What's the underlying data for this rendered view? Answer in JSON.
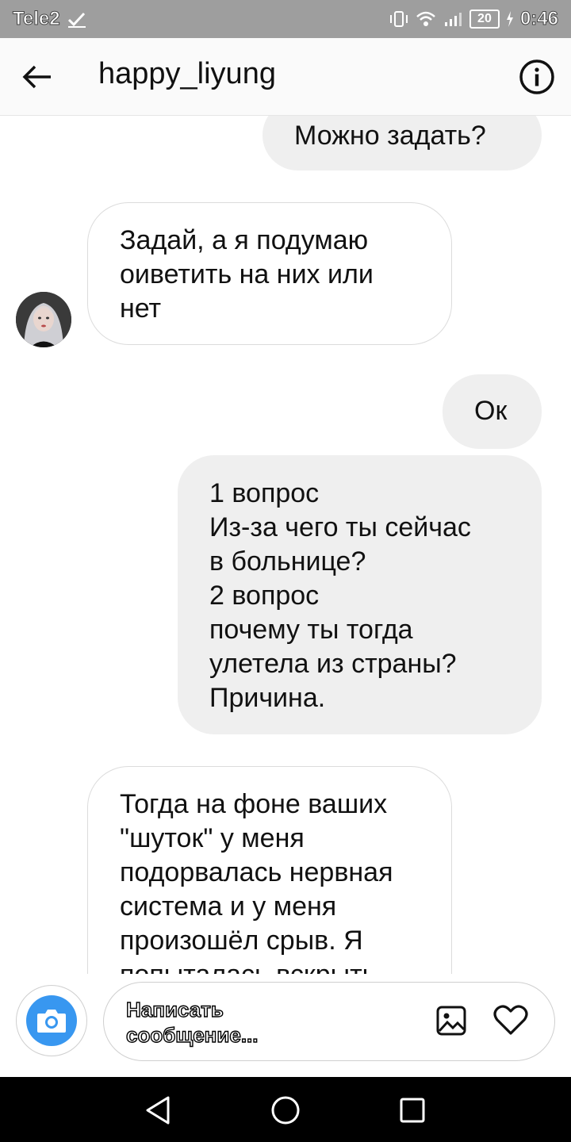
{
  "status_bar": {
    "carrier": "Tele2",
    "battery": "20",
    "time": "0:46",
    "icons": [
      "check-icon",
      "vibrate-icon",
      "wifi-icon",
      "signal-icon",
      "battery-icon",
      "charging-icon"
    ]
  },
  "header": {
    "username": "happy_liyung",
    "back_icon": "arrow-left-icon",
    "info_icon": "info-icon"
  },
  "messages": [
    {
      "sender": "me",
      "text": "Можно задать?"
    },
    {
      "sender": "them",
      "text": "Задай, а я подумаю\nоиветить на них или\nнет"
    },
    {
      "sender": "me",
      "text": "Ок"
    },
    {
      "sender": "me",
      "text": "1 вопрос\nИз-за чего ты сейчас\nв больнице?\n2 вопрос\n почему ты тогда\nулетела из страны?\nПричина."
    },
    {
      "sender": "them",
      "text": "Тогда на фоне ваших\n\"шуток\" у меня\nподорвалась нервная\nсистема и у меня\nпроизошёл срыв. Я\nпопыталась вскрыть"
    }
  ],
  "composer": {
    "placeholder": "Написать сообщение...",
    "camera_icon": "camera-icon",
    "gallery_icon": "image-icon",
    "like_icon": "heart-icon"
  },
  "colors": {
    "accent": "#3897f0",
    "outgoing_bubble": "#efefef",
    "statusbar": "#9e9e9e",
    "navbar": "#000000"
  },
  "nav_bar": {
    "icons": [
      "back-triangle-icon",
      "home-circle-icon",
      "recents-square-icon"
    ]
  }
}
